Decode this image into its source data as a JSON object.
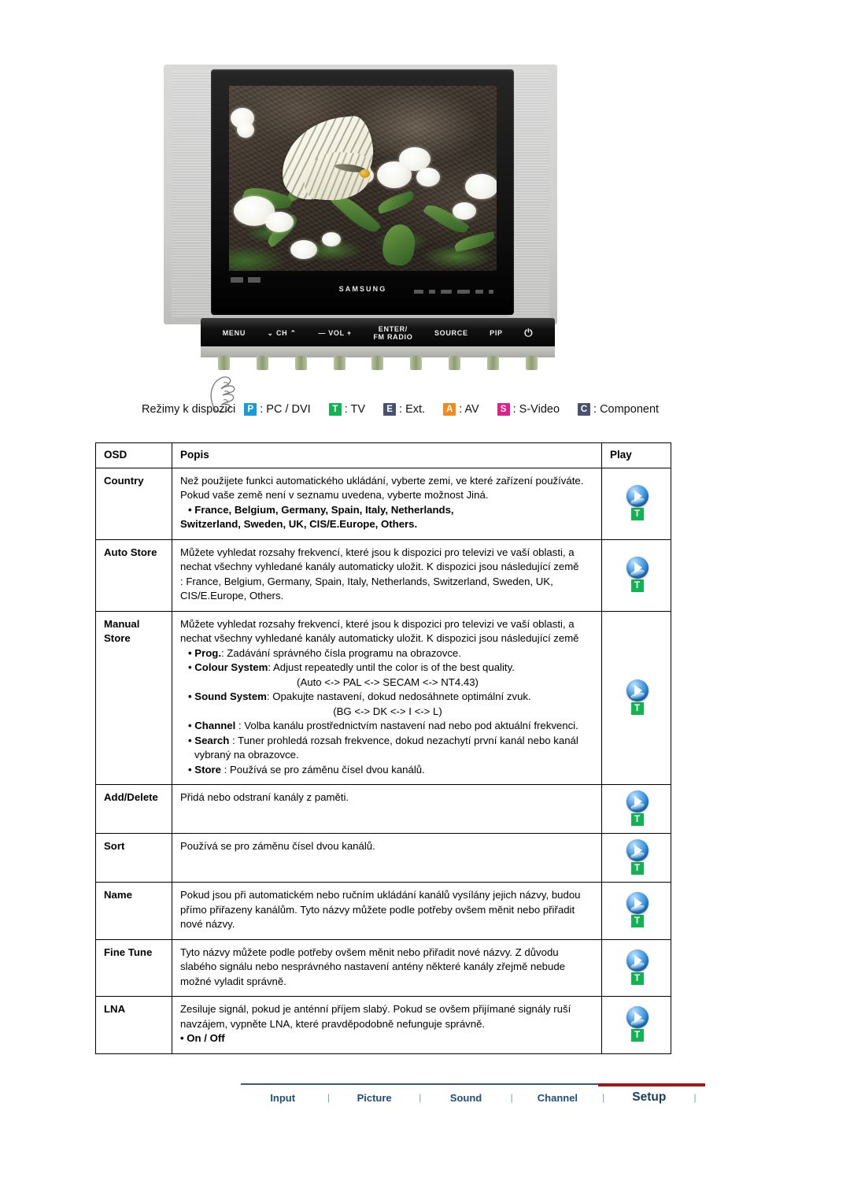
{
  "figure": {
    "brand": "SAMSUNG",
    "control_buttons": [
      "MENU",
      "⌄ CH ⌃",
      "— VOL +",
      "ENTER/\nFM RADIO",
      "SOURCE",
      "PIP",
      "⏻"
    ],
    "control_labels": {
      "menu": "MENU",
      "ch": "CH",
      "ch_down": "⌄",
      "ch_up": "⌃",
      "vol": "VOL",
      "vol_minus": "—",
      "vol_plus": "+",
      "enter": "ENTER/",
      "fm_radio": "FM RADIO",
      "source": "SOURCE",
      "pip": "PIP",
      "power": "⏻"
    }
  },
  "modes": {
    "lead": "Režimy k dispozici",
    "items": [
      {
        "badge": "P",
        "color": "#1b9ad6",
        "label": ": PC / DVI"
      },
      {
        "badge": "T",
        "color": "#12b352",
        "label": ": TV"
      },
      {
        "badge": "E",
        "color": "#4a5070",
        "label": ": Ext."
      },
      {
        "badge": "A",
        "color": "#f28a1e",
        "label": ": AV"
      },
      {
        "badge": "S",
        "color": "#e0218a",
        "label": ": S-Video"
      },
      {
        "badge": "C",
        "color": "#4a5070",
        "label": ": Component"
      }
    ]
  },
  "table": {
    "headers": {
      "osd": "OSD",
      "popis": "Popis",
      "play": "Play"
    },
    "rows": [
      {
        "osd": "Country",
        "lines": [
          {
            "type": "p",
            "text": "Než použijete funkci automatického ukládání, vyberte zemi, ve které zařízení používáte. Pokud vaše země není v seznamu uvedena, vyberte možnost Jiná."
          },
          {
            "type": "bullet-bold",
            "text": "• France, Belgium, Germany, Spain, Italy, Netherlands,"
          },
          {
            "type": "bold",
            "text": "Switzerland, Sweden, UK, CIS/E.Europe, Others."
          }
        ],
        "play": true
      },
      {
        "osd": "Auto Store",
        "lines": [
          {
            "type": "p",
            "text": "Můžete vyhledat rozsahy frekvencí, které jsou k dispozici pro televizi ve vaší oblasti, a nechat všechny vyhledané kanály automaticky uložit. K dispozici jsou následující země"
          },
          {
            "type": "p",
            "text": ": France, Belgium, Germany, Spain, Italy, Netherlands, Switzerland, Sweden, UK, CIS/E.Europe, Others."
          }
        ],
        "play": true
      },
      {
        "osd": "Manual Store",
        "osd_l1": "Manual",
        "osd_l2": "Store",
        "lines": [
          {
            "type": "p",
            "text": "Můžete vyhledat rozsahy frekvencí, které jsou k dispozici pro televizi ve vaší oblasti, a nechat všechny vyhledané kanály automaticky uložit. K dispozici jsou následující země"
          },
          {
            "type": "rich",
            "bold": "• Prog.",
            "rest": ": Zadávání správného čísla programu na obrazovce."
          },
          {
            "type": "rich",
            "bold": "• Colour System",
            "rest": ": Adjust repeatedly until the color is of the best quality."
          },
          {
            "type": "center",
            "text": "(Auto <-> PAL <-> SECAM <-> NT4.43)"
          },
          {
            "type": "rich",
            "bold": "• Sound System",
            "rest": ": Opakujte nastavení, dokud nedosáhnete optimální zvuk."
          },
          {
            "type": "center",
            "text": "(BG <-> DK <-> I <-> L)"
          },
          {
            "type": "rich",
            "bold": "• Channel",
            "rest": " : Volba kanálu prostřednictvím nastavení nad nebo pod aktuální frekvenci."
          },
          {
            "type": "rich",
            "bold": "• Search",
            "rest": " : Tuner prohledá rozsah frekvence, dokud nezachytí první kanál nebo kanál vybraný na obrazovce."
          },
          {
            "type": "rich",
            "bold": "• Store",
            "rest": " : Používá se pro záměnu čísel dvou kanálů."
          }
        ],
        "play": true
      },
      {
        "osd": "Add/Delete",
        "lines": [
          {
            "type": "p",
            "text": "Přidá nebo odstraní kanály z paměti."
          }
        ],
        "play": true
      },
      {
        "osd": "Sort",
        "lines": [
          {
            "type": "p",
            "text": "Používá se pro záměnu čísel dvou kanálů."
          }
        ],
        "play": true
      },
      {
        "osd": "Name",
        "lines": [
          {
            "type": "p",
            "text": "Pokud jsou při automatickém nebo ručním ukládání kanálů vysílány jejich názvy, budou přímo přiřazeny kanálům. Tyto názvy můžete podle potřeby ovšem měnit nebo přiřadit nové názvy."
          }
        ],
        "play": true
      },
      {
        "osd": "Fine Tune",
        "lines": [
          {
            "type": "p",
            "text": "Tyto názvy můžete podle potřeby ovšem měnit nebo přiřadit nové názvy. Z důvodu slabého signálu nebo nesprávného nastavení antény některé kanály zřejmě nebude možné vyladit správně."
          }
        ],
        "play": true
      },
      {
        "osd": "LNA",
        "lines": [
          {
            "type": "p",
            "text": "Zesiluje signál, pokud je anténní příjem slabý. Pokud se ovšem přijímané signály ruší navzájem, vypněte LNA, které pravděpodobně nefunguje správně."
          },
          {
            "type": "bold",
            "text": "• On / Off"
          }
        ],
        "play": true
      }
    ]
  },
  "footer": {
    "items": [
      {
        "label": "Input",
        "active": false
      },
      {
        "label": "Picture",
        "active": false
      },
      {
        "label": "Sound",
        "active": false
      },
      {
        "label": "Channel",
        "active": false
      },
      {
        "label": "Setup",
        "active": true
      }
    ],
    "separator": "|",
    "accent_color": "#9e1b1b",
    "rule_color": "#3c5a77"
  }
}
